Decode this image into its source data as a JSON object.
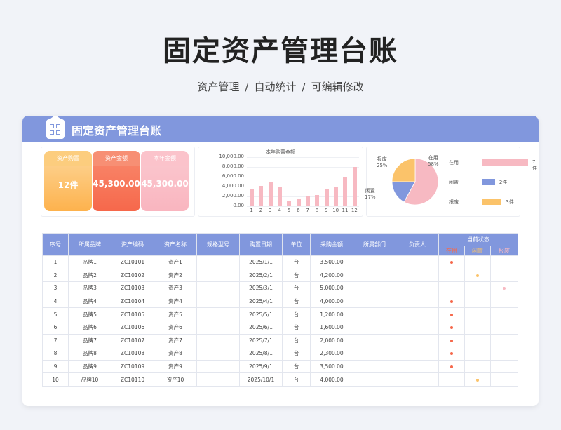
{
  "page": {
    "title": "固定资产管理台账",
    "subtitle_parts": [
      "资产管理",
      "/",
      "自动统计",
      "/",
      "可编辑修改"
    ]
  },
  "sheet": {
    "header_title": "固定资产管理台账",
    "icon": "document-grid-icon"
  },
  "kpi_cards": [
    {
      "title": "资产购置",
      "value": "12件",
      "color_top": "#fccd7e",
      "color_bottom": "#fdb24d"
    },
    {
      "title": "资产金额",
      "value": "45,300.00",
      "color_top": "#f98a6e",
      "color_bottom": "#f6684b"
    },
    {
      "title": "本年金额",
      "value": "45,300.00",
      "color_top": "#fbc3cb",
      "color_bottom": "#f9b5bf"
    }
  ],
  "chart_data": [
    {
      "type": "bar",
      "title": "本年购置金额",
      "categories": [
        "1",
        "2",
        "3",
        "4",
        "5",
        "6",
        "7",
        "8",
        "9",
        "10",
        "11",
        "12"
      ],
      "values": [
        3500,
        4200,
        5000,
        4000,
        1200,
        1600,
        2000,
        2300,
        3500,
        4000,
        6000,
        8000
      ],
      "ylim": [
        0,
        10000
      ],
      "yticks": [
        "10,000.00",
        "8,000.00",
        "6,000.00",
        "4,000.00",
        "2,000.00",
        "0.00"
      ],
      "bar_color": "#f7b9c2"
    },
    {
      "type": "pie",
      "categories": [
        "在用",
        "闲置",
        "报废"
      ],
      "values": [
        58,
        17,
        25
      ],
      "labels": [
        "在用\n58%",
        "闲置\n17%",
        "报废\n25%"
      ],
      "colors": [
        "#f7b9c2",
        "#8197dd",
        "#fbc36a"
      ]
    },
    {
      "type": "bar",
      "orientation": "horizontal",
      "categories": [
        "在用",
        "闲置",
        "报废"
      ],
      "values": [
        7,
        2,
        3
      ],
      "value_labels": [
        "7件",
        "2件",
        "3件"
      ],
      "colors": [
        "#f7b9c2",
        "#8197dd",
        "#fbc36a"
      ]
    }
  ],
  "table": {
    "headers": [
      "序号",
      "所属品牌",
      "资产编码",
      "资产名称",
      "规格型号",
      "购置日期",
      "单位",
      "采购金额",
      "所属部门",
      "负责人",
      "当前状态"
    ],
    "status_headers": [
      "在用",
      "闲置",
      "报废"
    ],
    "status_colors": {
      "在用": "#f6684b",
      "闲置": "#fbc36a",
      "报废": "#f7b9c2"
    },
    "rows": [
      {
        "no": "1",
        "brand": "品牌1",
        "code": "ZC10101",
        "name": "资产1",
        "spec": "",
        "date": "2025/1/1",
        "unit": "台",
        "amount": "3,500.00",
        "dept": "",
        "owner": "",
        "status": "在用"
      },
      {
        "no": "2",
        "brand": "品牌2",
        "code": "ZC10102",
        "name": "资产2",
        "spec": "",
        "date": "2025/2/1",
        "unit": "台",
        "amount": "4,200.00",
        "dept": "",
        "owner": "",
        "status": "闲置"
      },
      {
        "no": "3",
        "brand": "品牌3",
        "code": "ZC10103",
        "name": "资产3",
        "spec": "",
        "date": "2025/3/1",
        "unit": "台",
        "amount": "5,000.00",
        "dept": "",
        "owner": "",
        "status": "报废"
      },
      {
        "no": "4",
        "brand": "品牌4",
        "code": "ZC10104",
        "name": "资产4",
        "spec": "",
        "date": "2025/4/1",
        "unit": "台",
        "amount": "4,000.00",
        "dept": "",
        "owner": "",
        "status": "在用"
      },
      {
        "no": "5",
        "brand": "品牌5",
        "code": "ZC10105",
        "name": "资产5",
        "spec": "",
        "date": "2025/5/1",
        "unit": "台",
        "amount": "1,200.00",
        "dept": "",
        "owner": "",
        "status": "在用"
      },
      {
        "no": "6",
        "brand": "品牌6",
        "code": "ZC10106",
        "name": "资产6",
        "spec": "",
        "date": "2025/6/1",
        "unit": "台",
        "amount": "1,600.00",
        "dept": "",
        "owner": "",
        "status": "在用"
      },
      {
        "no": "7",
        "brand": "品牌7",
        "code": "ZC10107",
        "name": "资产7",
        "spec": "",
        "date": "2025/7/1",
        "unit": "台",
        "amount": "2,000.00",
        "dept": "",
        "owner": "",
        "status": "在用"
      },
      {
        "no": "8",
        "brand": "品牌8",
        "code": "ZC10108",
        "name": "资产8",
        "spec": "",
        "date": "2025/8/1",
        "unit": "台",
        "amount": "2,300.00",
        "dept": "",
        "owner": "",
        "status": "在用"
      },
      {
        "no": "9",
        "brand": "品牌9",
        "code": "ZC10109",
        "name": "资产9",
        "spec": "",
        "date": "2025/9/1",
        "unit": "台",
        "amount": "3,500.00",
        "dept": "",
        "owner": "",
        "status": "在用"
      },
      {
        "no": "10",
        "brand": "品牌10",
        "code": "ZC10110",
        "name": "资产10",
        "spec": "",
        "date": "2025/10/1",
        "unit": "台",
        "amount": "4,000.00",
        "dept": "",
        "owner": "",
        "status": "闲置"
      }
    ]
  }
}
